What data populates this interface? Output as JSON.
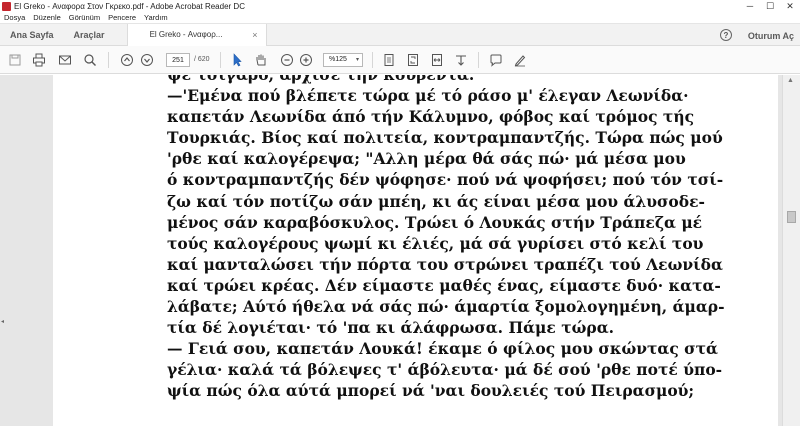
{
  "window": {
    "title": "El Greko - Αναφορα Στον Γκρεκο.pdf - Adobe Acrobat Reader DC",
    "controls": {
      "minimize": "─",
      "maximize": "☐",
      "close": "✕"
    }
  },
  "menu": {
    "items": [
      "Dosya",
      "Düzenle",
      "Görünüm",
      "Pencere",
      "Yardım"
    ]
  },
  "tabs": {
    "home": "Ana Sayfa",
    "tools": "Araçlar",
    "document": "El Greko - Αναφορ...",
    "close": "×",
    "help": "?",
    "signin": "Oturum Aç"
  },
  "toolbar": {
    "icons": [
      "save-icon",
      "print-icon",
      "email-icon",
      "search-icon",
      "page-up-icon",
      "page-down-icon",
      "select-cursor-icon",
      "hand-icon",
      "zoom-out-icon",
      "zoom-in-icon",
      "fit-page-icon",
      "full-screen-icon",
      "fit-width-icon",
      "rotate-icon",
      "comment-icon",
      "sign-icon"
    ],
    "page_current": "251",
    "page_total": "/ 620",
    "zoom": "%125",
    "zoom_caret": "▾"
  },
  "document": {
    "lines": [
      "ψε τσιγάρο, άρχισε την κουβέντα.",
      "—'Εμένα πού βλέπετε τώρα μέ τό ράσο μ' έλεγαν Λεωνίδα·",
      "καπετάν Λεωνίδα άπό τήν Κάλυμνο, φόβος καί τρόμος τής",
      "Τουρκιάς. Βίος καί πολιτεία, κοντραμπαντζής. Τώρα πώς μού",
      "'ρθε καί καλογέρεψα; \"Αλλη μέρα θά σάς πώ· μά μέσα μου",
      "ό κοντραμπαντζής δέν ψόφησε· πού νά ψοφήσει; πού τόν τσί-",
      "ζω καί τόν ποτίζω σάν μπέη, κι άς είναι μέσα μου άλυσοδε-",
      "μένος σάν καραβόσκυλος. Τρώει ό Λουκάς στήν Τράπεζα μέ",
      "τούς καλογέρους ψωμί κι έλιές, μά σά γυρίσει στό κελί του",
      "καί μανταλώσει τήν πόρτα του στρώνει τραπέζι τού Λεωνίδα",
      "καί τρώει κρέας. Δέν είμαστε μαθές ένας, είμαστε δυό· κατα-",
      "λάβατε; Αύτό ήθελα νά σάς πώ· άμαρτία ξομολογημένη, άμαρ-",
      "τία δέ λογιέται· τό 'πα κι άλάφρωσα. Πάμε τώρα.",
      "— Γειά σου, καπετάν Λουκά! έκαμε ό φίλος μου σκώντας στά",
      "γέλια· καλά τά βόλεψες τ' άβόλευτα· μά δέ σού 'ρθε ποτέ ύπο-",
      "ψία πώς όλα αύτά μπορεί νά 'ναι δουλειές τού Πειρασμού;"
    ]
  },
  "side_handles": {
    "left": "◂",
    "right": "▸"
  },
  "scrollbar": {
    "up": "▲"
  }
}
